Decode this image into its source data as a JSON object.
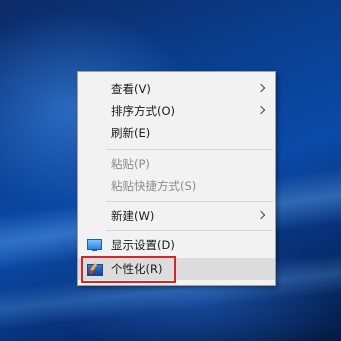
{
  "desktop": {
    "wallpaper": "windows-10-hero-blue"
  },
  "context_menu": {
    "items": [
      {
        "label": "查看(V)",
        "has_submenu": true,
        "disabled": false
      },
      {
        "label": "排序方式(O)",
        "has_submenu": true,
        "disabled": false
      },
      {
        "label": "刷新(E)",
        "has_submenu": false,
        "disabled": false
      },
      {
        "label": "粘贴(P)",
        "has_submenu": false,
        "disabled": true
      },
      {
        "label": "粘贴快捷方式(S)",
        "has_submenu": false,
        "disabled": true
      },
      {
        "label": "新建(W)",
        "has_submenu": true,
        "disabled": false
      },
      {
        "label": "显示设置(D)",
        "icon": "display-settings-icon",
        "disabled": false
      },
      {
        "label": "个性化(R)",
        "icon": "personalize-icon",
        "disabled": false,
        "hovered": true
      }
    ]
  },
  "annotation": {
    "highlight_color": "#d32626",
    "target_item": "个性化(R)"
  },
  "colors": {
    "menu_bg": "#f2f2f2",
    "hover_bg": "#dcdcdc",
    "disabled_text": "#8c8c8c"
  }
}
